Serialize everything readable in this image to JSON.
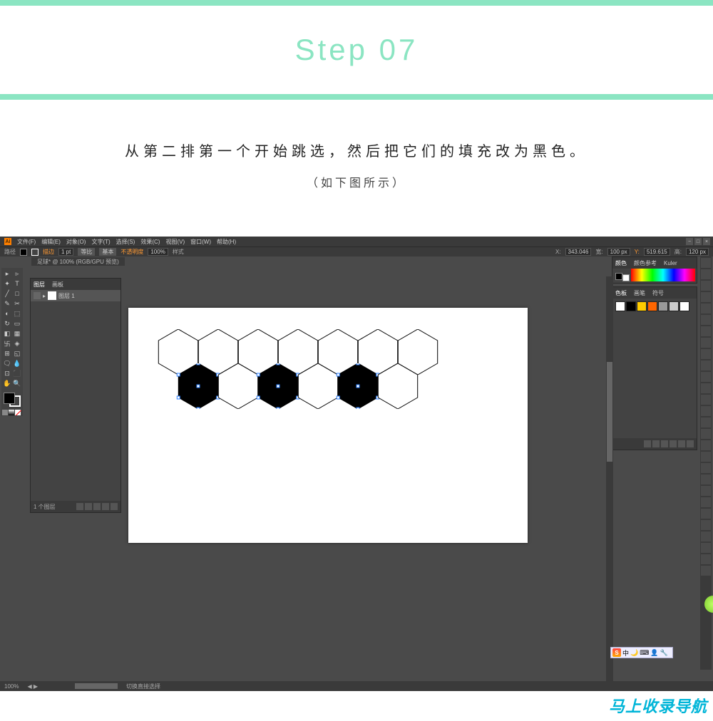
{
  "tutorial": {
    "step_title": "Step 07",
    "instruction": "从第二排第一个开始跳选，然后把它们的填充改为黑色。",
    "subnote": "（如下图所示）"
  },
  "app": {
    "logo": "Ai",
    "menus": [
      "文件(F)",
      "编辑(E)",
      "对象(O)",
      "文字(T)",
      "选择(S)",
      "效果(C)",
      "视图(V)",
      "窗口(W)",
      "帮助(H)"
    ],
    "window_controls": [
      "−",
      "□",
      "×"
    ]
  },
  "controlbar": {
    "label": "路径",
    "stroke_label": "描边",
    "stroke_val": "1 pt",
    "uniform": "等比",
    "basic": "基本",
    "opacity_label": "不透明度",
    "opacity_val": "100%",
    "style_label": "样式",
    "x_label": "X:",
    "x_val": "343.046",
    "w_label": "宽:",
    "w_val": "100 px",
    "y_label": "Y:",
    "y_val": "519.615",
    "h_label": "高:",
    "h_val": "120 px"
  },
  "doctab": {
    "title": "足球* @ 100% (RGB/GPU 预览)"
  },
  "layers_panel": {
    "tab1": "图层",
    "tab2": "画板",
    "layer_name": "图层 1",
    "footer": "1 个图层"
  },
  "color_panel": {
    "tab1": "颜色",
    "tab2": "颜色参考",
    "tab3": "Kuler"
  },
  "swatches_panel": {
    "tab1": "色板",
    "tab2": "画笔",
    "tab3": "符号",
    "colors": [
      "#ffffff",
      "#000000",
      "#ffcc00",
      "#ff6600",
      "#999999",
      "#cccccc",
      "#ffffff"
    ]
  },
  "tools": [
    "▸",
    "▹",
    "✦",
    "T",
    "╱",
    "□",
    "✎",
    "✂",
    "◐",
    "⬚",
    "↻",
    "▭",
    "◧",
    "▦",
    "卐",
    "◈",
    "⊞",
    "◱",
    "🗨",
    "💧",
    "⊡",
    "⬛",
    "✋",
    "🔍"
  ],
  "status": {
    "zoom": "100%",
    "info": "切换直接选择"
  },
  "ime": {
    "s": "S",
    "zh": "中"
  },
  "watermark": "马上收录导航",
  "hexagons": {
    "row1_count": 7,
    "row2_count": 6,
    "black_indices_row2": [
      0,
      2,
      4
    ]
  }
}
